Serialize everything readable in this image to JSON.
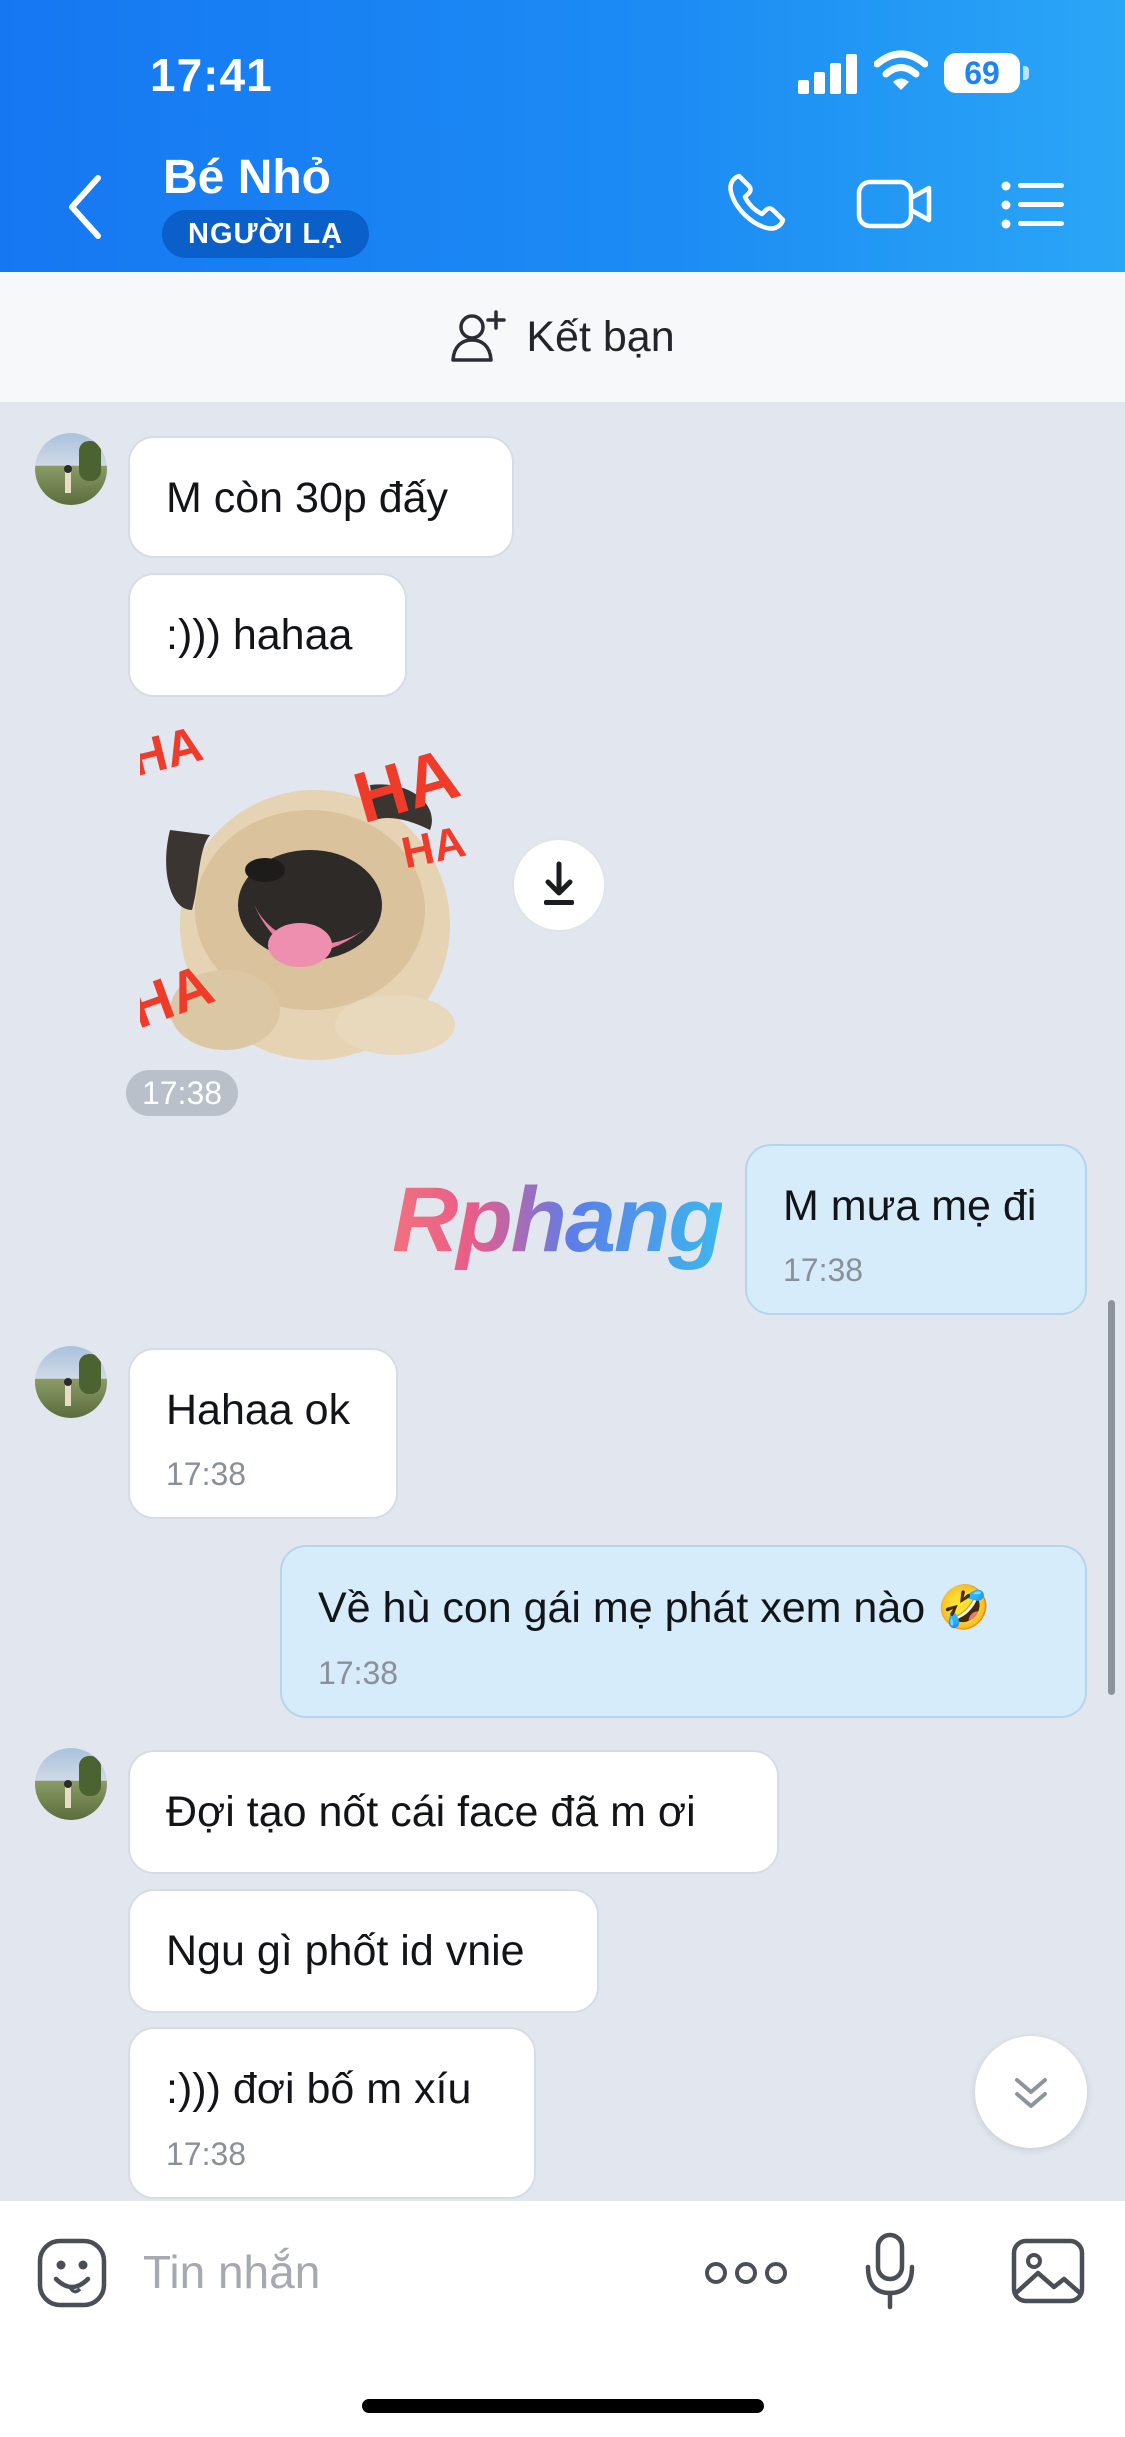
{
  "status_bar": {
    "time": "17:41",
    "battery": "69"
  },
  "header": {
    "title": "Bé Nhỏ",
    "badge": "NGƯỜI LẠ"
  },
  "friend_bar": {
    "label": "Kết bạn"
  },
  "messages": [
    {
      "text": "M còn 30p đấy"
    },
    {
      "text": ":))) hahaa"
    },
    {
      "sticker_time": "17:38"
    },
    {
      "text": "M mưa mẹ đi",
      "time": "17:38"
    },
    {
      "text": "Hahaa ok",
      "time": "17:38"
    },
    {
      "text": "Về hù con gái mẹ phát xem nào 🤣",
      "time": "17:38"
    },
    {
      "text": "Đợi tạo nốt cái face đã m ơi"
    },
    {
      "text": "Ngu gì phốt id vnie"
    },
    {
      "text": ":))) đơi bố m xíu",
      "time": "17:38"
    }
  ],
  "sticker": {
    "texts": [
      "HA",
      "HA",
      "HA",
      "HA"
    ]
  },
  "watermark": "Rphang",
  "composer": {
    "placeholder": "Tin nhắn"
  },
  "icons": {
    "back": "chevron-left-icon",
    "call": "phone-icon",
    "video": "video-camera-icon",
    "menu": "list-menu-icon",
    "add_friend": "add-user-icon",
    "download": "download-icon",
    "scroll_down": "double-chevron-down-icon",
    "emoji": "emoji-icon",
    "more": "more-dots-icon",
    "mic": "microphone-icon",
    "image": "image-icon"
  },
  "colors": {
    "header": "#1677f2",
    "outgoing_bubble": "#d6ecfb",
    "chat_bg": "#e2e7ef"
  }
}
